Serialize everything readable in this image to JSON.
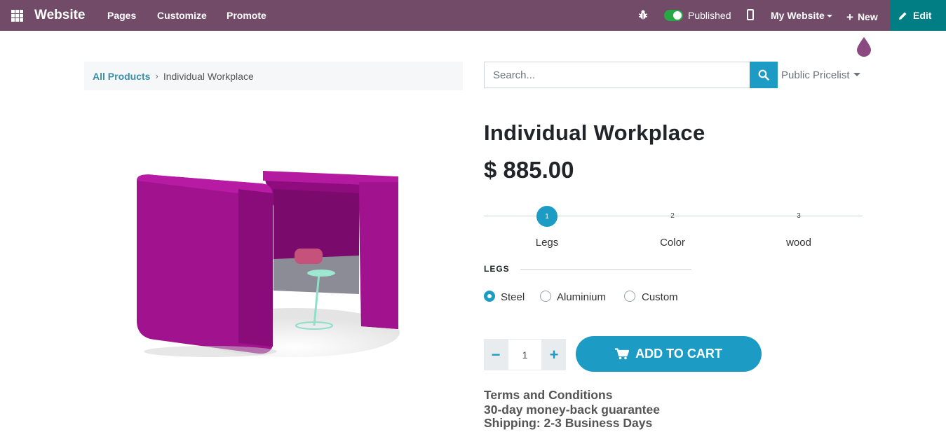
{
  "topbar": {
    "brand": "Website",
    "nav": [
      "Pages",
      "Customize",
      "Promote"
    ],
    "published_label": "Published",
    "my_website_label": "My Website",
    "new_label": "New",
    "edit_label": "Edit",
    "published": true
  },
  "breadcrumb": {
    "link": "All Products",
    "current": "Individual Workplace"
  },
  "search": {
    "placeholder": "Search..."
  },
  "pricelist": "Public Pricelist",
  "product": {
    "title": "Individual Workplace",
    "price": "$ 885.00"
  },
  "steps": [
    {
      "number": "1",
      "label": "Legs",
      "active": true
    },
    {
      "number": "2",
      "label": "Color",
      "active": false
    },
    {
      "number": "3",
      "label": "wood",
      "active": false
    }
  ],
  "legs": {
    "heading": "LEGS",
    "options": [
      {
        "label": "Steel",
        "selected": true
      },
      {
        "label": "Aluminium",
        "selected": false
      },
      {
        "label": "Custom",
        "selected": false
      }
    ]
  },
  "quantity": {
    "value": "1",
    "minus": "−",
    "plus": "+"
  },
  "cart": {
    "label": "ADD TO CART"
  },
  "terms": [
    "Terms and Conditions",
    "30-day money-back guarantee",
    "Shipping: 2-3 Business Days"
  ],
  "colors": {
    "topbar": "#714b67",
    "edit": "#017e84",
    "accent": "#1c9cc4",
    "product": "#a0128e"
  }
}
